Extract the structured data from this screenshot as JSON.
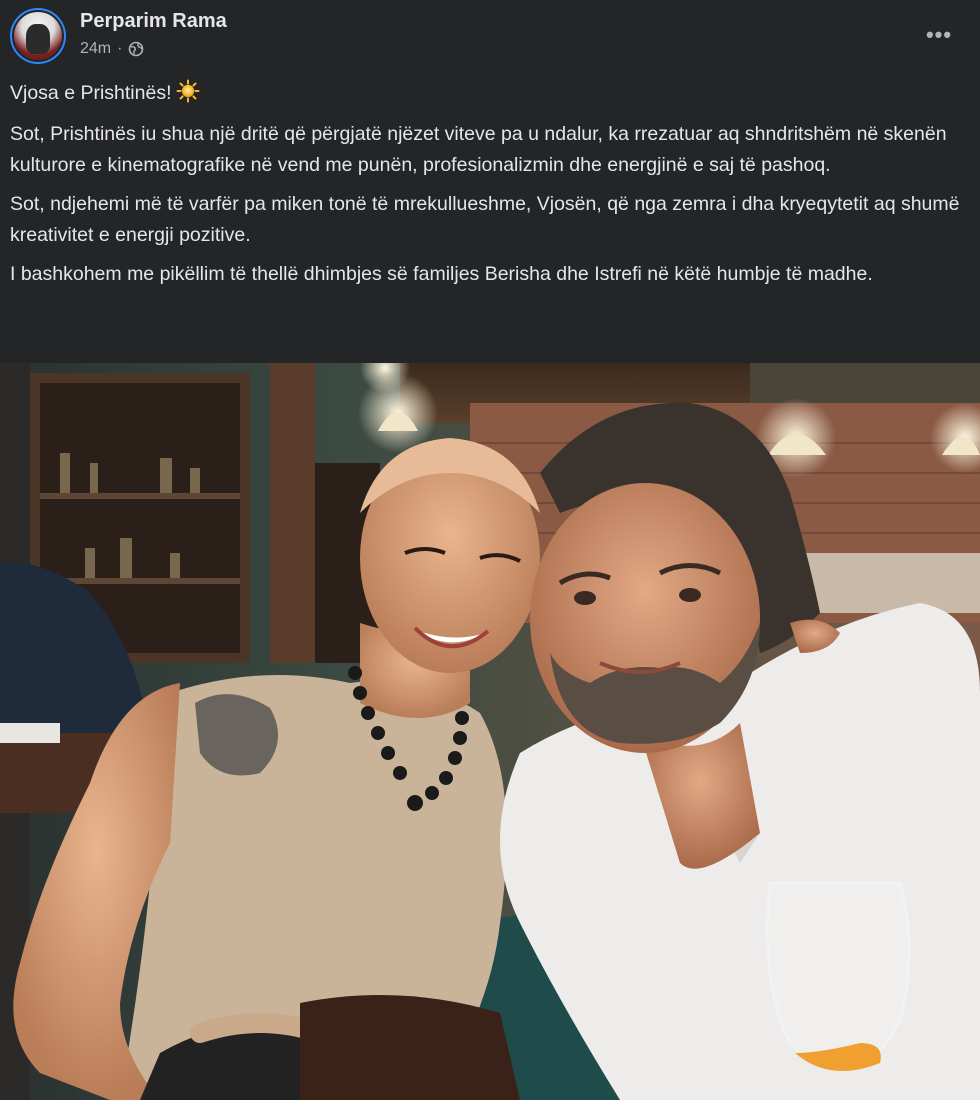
{
  "post": {
    "author": "Perparim Rama",
    "timestamp": "24m",
    "separator": "·",
    "privacy_icon": "globe-icon",
    "more_label": "•••",
    "paragraphs": [
      "Vjosa e Prishtinës!",
      "Sot, Prishtinës iu shua një dritë që përgjatë njëzet viteve pa u ndalur, ka rrezatuar aq shndritshëm në skenën kulturore e kinematografike në vend me punën, profesionalizmin dhe energjinë e saj të pashoq.",
      "Sot, ndjehemi më të varfër pa miken tonë të mrekullueshme, Vjosën, që nga zemra i dha kryeqytetit aq shumë kreativitet e energji pozitive.",
      "I bashkohem me pikëllim të thellë dhimbjes së familjes Berisha dhe Istrefi në këtë humbje të madhe."
    ],
    "title_emoji": "sun-icon"
  },
  "colors": {
    "background": "#242526",
    "text": "#e4e6eb",
    "secondary_text": "#b0b3b8",
    "avatar_ring": "#2d88ff"
  }
}
